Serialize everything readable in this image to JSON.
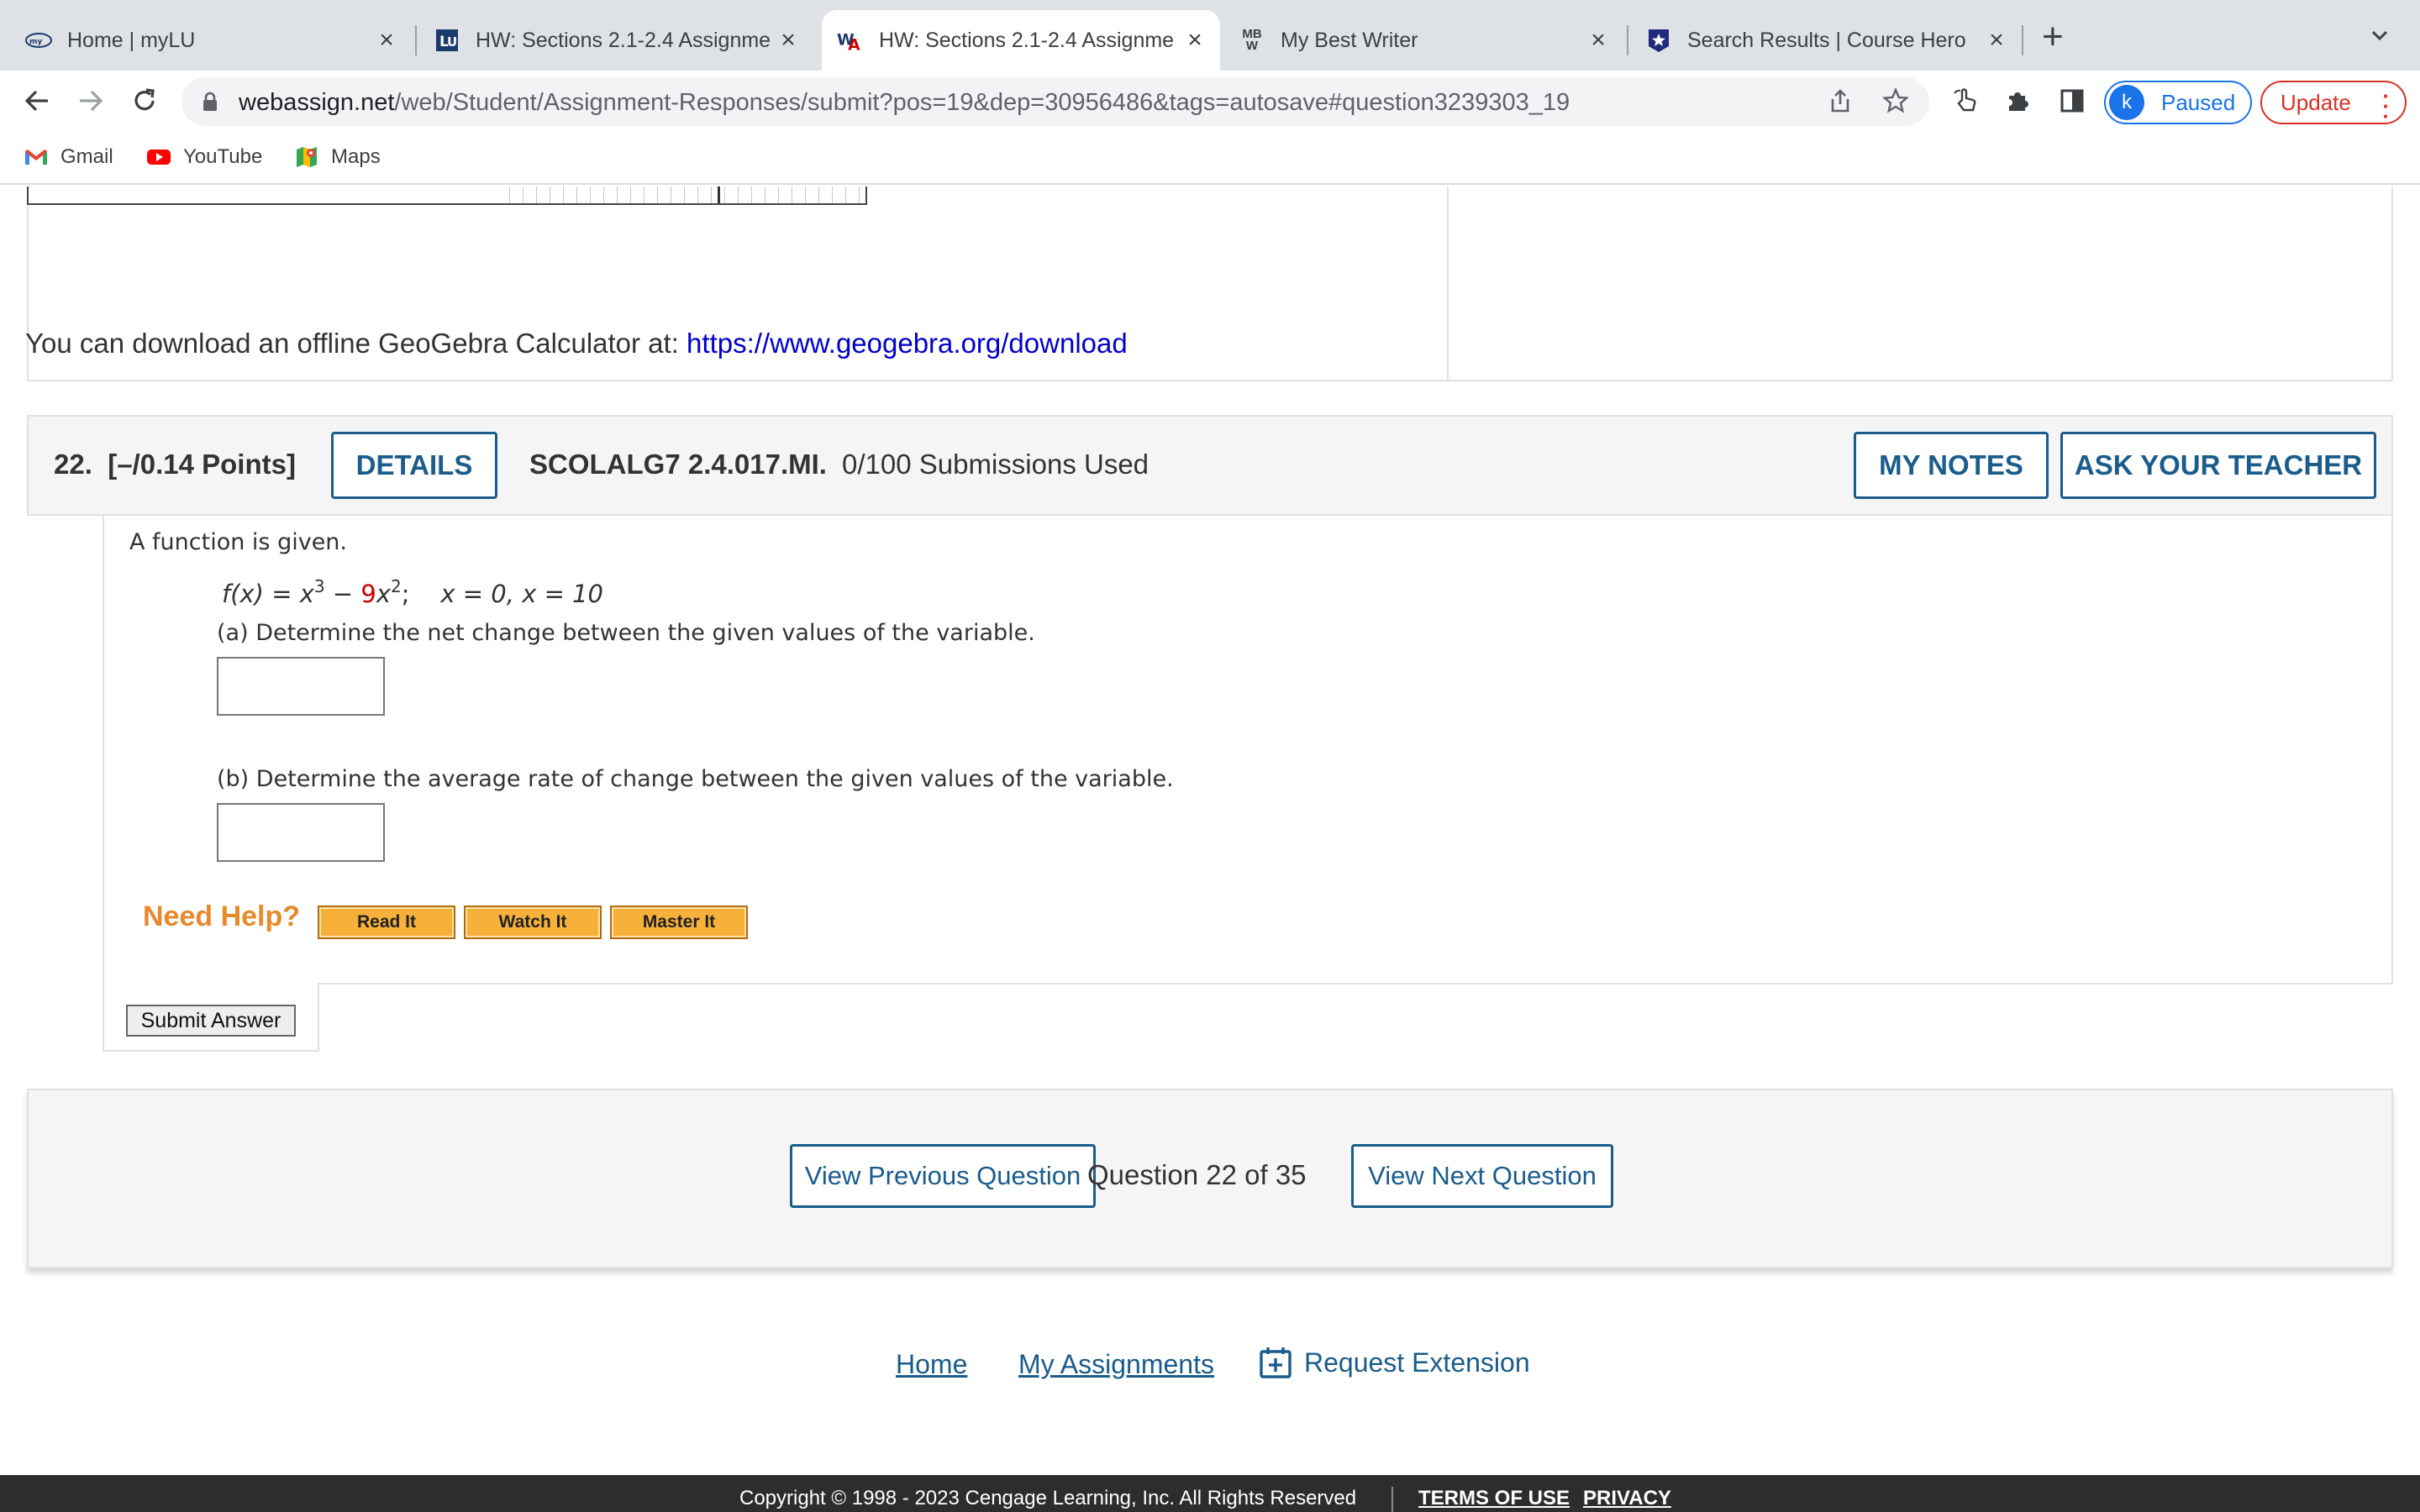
{
  "browser": {
    "tabs": [
      {
        "title": "Home | myLU",
        "favicon": "mylu-logo-icon"
      },
      {
        "title": "HW: Sections 2.1-2.4 Assignme",
        "favicon": "lu-logo-icon"
      },
      {
        "title": "HW: Sections 2.1-2.4 Assignme",
        "favicon": "webassign-logo-icon",
        "active": true
      },
      {
        "title": "My Best Writer",
        "favicon": "mbw-logo-icon",
        "favicon_text": "MBW"
      },
      {
        "title": "Search Results | Course Hero",
        "favicon": "course-hero-logo-icon"
      }
    ],
    "url_host": "webassign.net",
    "url_path": "/web/Student/Assignment-Responses/submit?pos=19&dep=30956486&tags=autosave#question3239303_19",
    "profile_initial": "k",
    "profile_label": "Paused",
    "update_label": "Update",
    "bookmarks": [
      {
        "label": "Gmail",
        "icon": "gmail-icon"
      },
      {
        "label": "YouTube",
        "icon": "youtube-icon"
      },
      {
        "label": "Maps",
        "icon": "maps-icon"
      }
    ],
    "colors": {
      "accent": "#1a73e8",
      "update": "#d93025"
    }
  },
  "prev_question": {
    "geogebra_text": "You can download an offline GeoGebra Calculator at: ",
    "geogebra_link": "https://www.geogebra.org/download"
  },
  "question": {
    "number": "22.",
    "points": "[–/0.14 Points]",
    "details_label": "DETAILS",
    "code": "SCOLALG7 2.4.017.MI.",
    "submissions": "0/100 Submissions Used",
    "my_notes_label": "MY NOTES",
    "ask_teacher_label": "ASK YOUR TEACHER",
    "intro": "A function is given.",
    "function": {
      "lhs": "f(x) = x",
      "exp1": "3",
      "minus": " − ",
      "coef": "9",
      "var": "x",
      "exp2": "2",
      "semi": ";",
      "domain": "x = 0, x = 10"
    },
    "part_a": "(a) Determine the net change between the given values of the variable.",
    "part_b": "(b) Determine the average rate of change between the given values of the variable.",
    "answer_a": "",
    "answer_b": "",
    "need_help": "Need Help?",
    "help_buttons": [
      "Read It",
      "Watch It",
      "Master It"
    ],
    "submit_label": "Submit Answer"
  },
  "navigation": {
    "prev_label": "View Previous Question",
    "position": "Question 22 of 35",
    "next_label": "View Next Question"
  },
  "footer_links": {
    "home": "Home",
    "assignments": "My Assignments",
    "extension": "Request Extension"
  },
  "footer": {
    "copyright": "Copyright © 1998 - 2023 Cengage Learning, Inc. All Rights Reserved",
    "terms": "TERMS OF USE",
    "privacy": "PRIVACY"
  },
  "colors": {
    "link": "#1a5c8c",
    "need_help": "#e8892c",
    "help_button": "#f7b03a",
    "coef_red": "#cc0000"
  }
}
